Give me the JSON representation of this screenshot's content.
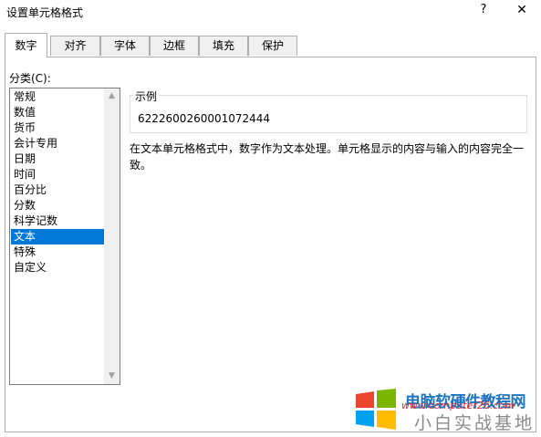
{
  "dialog": {
    "title": "设置单元格格式",
    "help_label": "?",
    "close_label": "✕"
  },
  "tabs": [
    "数字",
    "对齐",
    "字体",
    "边框",
    "填充",
    "保护"
  ],
  "active_tab": "数字",
  "category": {
    "label": "分类(C):",
    "items": [
      "常规",
      "数值",
      "货币",
      "会计专用",
      "日期",
      "时间",
      "百分比",
      "分数",
      "科学记数",
      "文本",
      "特殊",
      "自定义"
    ],
    "selected": "文本"
  },
  "sample": {
    "label": "示例",
    "value": "6222600260001072444"
  },
  "description": "在文本单元格格式中，数字作为文本处理。单元格显示的内容与输入的内容完全一致。",
  "watermark": {
    "line1": "电脑软硬件教程网",
    "url": "www.computer26.com",
    "line2": "小白实战基地"
  },
  "colors": {
    "selection": "#0078d7",
    "watermark_blue": "#1e73be",
    "watermark_red": "#e03030"
  }
}
